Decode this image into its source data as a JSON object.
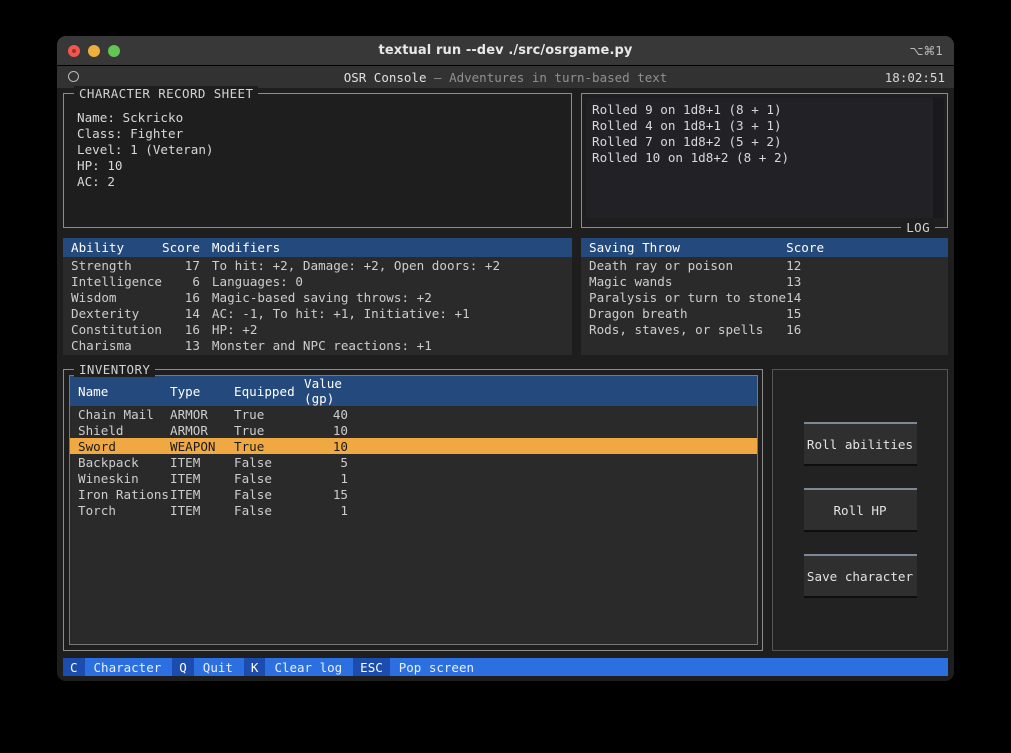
{
  "window": {
    "title": "textual run --dev ./src/osrgame.py",
    "shortcut": "⌥⌘1",
    "traffic_lights": [
      "close",
      "minimize",
      "zoom"
    ]
  },
  "app_header": {
    "title": "OSR Console",
    "separator": " — ",
    "subtitle": "Adventures in turn-based text",
    "clock": "18:02:51"
  },
  "character_sheet": {
    "legend": "CHARACTER RECORD SHEET",
    "lines": [
      "Name: Sckricko",
      "Class: Fighter",
      "Level: 1 (Veteran)",
      "HP: 10",
      "AC: 2"
    ]
  },
  "log": {
    "legend": "LOG",
    "lines": [
      "Rolled 9 on 1d8+1 (8 + 1)",
      "Rolled 4 on 1d8+1 (3 + 1)",
      "Rolled 7 on 1d8+2 (5 + 2)",
      "Rolled 10 on 1d8+2 (8 + 2)"
    ]
  },
  "abilities_table": {
    "columns": [
      "Ability",
      "Score",
      "Modifiers"
    ],
    "rows": [
      [
        "Strength",
        "17",
        "To hit: +2, Damage: +2, Open doors: +2"
      ],
      [
        "Intelligence",
        "6",
        "Languages: 0"
      ],
      [
        "Wisdom",
        "16",
        "Magic-based saving throws: +2"
      ],
      [
        "Dexterity",
        "14",
        "AC: -1, To hit: +1, Initiative: +1"
      ],
      [
        "Constitution",
        "16",
        "HP: +2"
      ],
      [
        "Charisma",
        "13",
        "Monster and NPC reactions: +1"
      ]
    ]
  },
  "saving_throws_table": {
    "columns": [
      "Saving Throw",
      "Score"
    ],
    "rows": [
      [
        "Death ray or poison",
        "12"
      ],
      [
        "Magic wands",
        "13"
      ],
      [
        "Paralysis or turn to stone",
        "14"
      ],
      [
        "Dragon breath",
        "15"
      ],
      [
        "Rods, staves, or spells",
        "16"
      ]
    ]
  },
  "inventory": {
    "legend": "INVENTORY",
    "columns": [
      "Name",
      "Type",
      "Equipped",
      "Value (gp)"
    ],
    "rows": [
      {
        "name": "Chain Mail",
        "type": "ARMOR",
        "equipped": "True",
        "value": "40",
        "selected": false
      },
      {
        "name": "Shield",
        "type": "ARMOR",
        "equipped": "True",
        "value": "10",
        "selected": false
      },
      {
        "name": "Sword",
        "type": "WEAPON",
        "equipped": "True",
        "value": "10",
        "selected": true
      },
      {
        "name": "Backpack",
        "type": "ITEM",
        "equipped": "False",
        "value": "5",
        "selected": false
      },
      {
        "name": "Wineskin",
        "type": "ITEM",
        "equipped": "False",
        "value": "1",
        "selected": false
      },
      {
        "name": "Iron Rations",
        "type": "ITEM",
        "equipped": "False",
        "value": "15",
        "selected": false
      },
      {
        "name": "Torch",
        "type": "ITEM",
        "equipped": "False",
        "value": "1",
        "selected": false
      }
    ]
  },
  "buttons": [
    {
      "label": "Roll abilities",
      "name": "roll-abilities-button"
    },
    {
      "label": "Roll HP",
      "name": "roll-hp-button"
    },
    {
      "label": "Save character",
      "name": "save-character-button"
    }
  ],
  "footer": [
    {
      "key": "C",
      "desc": "Character"
    },
    {
      "key": "Q",
      "desc": "Quit"
    },
    {
      "key": "K",
      "desc": "Clear log"
    },
    {
      "key": "ESC",
      "desc": "Pop screen"
    }
  ],
  "colors": {
    "accent_blue": "#24497c",
    "footer_blue": "#2b6fe0",
    "footer_key_blue": "#1b4cae",
    "selection_orange": "#f0a842",
    "terminal_bg": "#1e1e1e",
    "table_bg": "#2a2a2a"
  }
}
